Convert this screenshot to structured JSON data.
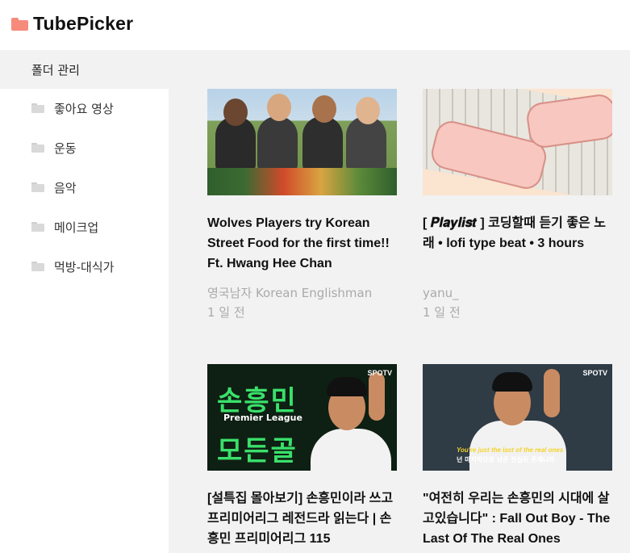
{
  "app": {
    "name": "TubePicker"
  },
  "sidebar": {
    "header": "폴더 관리",
    "items": [
      {
        "label": "좋아요 영상"
      },
      {
        "label": "운동"
      },
      {
        "label": "음악"
      },
      {
        "label": "메이크업"
      },
      {
        "label": "먹방-대식가"
      }
    ]
  },
  "videos": [
    {
      "title": "Wolves Players try Korean Street Food for the first time!! Ft. Hwang Hee Chan",
      "channel": "영국남자 Korean Englishman",
      "date": "1 일 전"
    },
    {
      "title": "[ 𝑷𝒍𝒂𝒚𝒍𝒊𝒔𝒕 ] 코딩할때 듣기 좋은 노래 • lofi type beat • 3 hours",
      "channel": "yanu_",
      "date": "1 일 전"
    },
    {
      "title": "[설특집 몰아보기] 손흥민이라 쓰고 프리미어리그 레전드라 읽는다 | 손흥민 프리미어리그 115",
      "thumb_text": {
        "line1": "손흥민",
        "line2": "모든골",
        "league": "Premier League",
        "badge": "SPOTV"
      }
    },
    {
      "title": "\"여전히 우리는 손흥민의 시대에 살고있습니다\" : Fall Out Boy - The Last Of The Real Ones",
      "thumb_text": {
        "caption_en": "You're just the last of the real ones",
        "caption_ko": "넌 마지막으로 남은 진실된 존재니까",
        "badge": "SPOTV"
      }
    }
  ],
  "colors": {
    "brand": "#f68a7b",
    "main_bg": "#f2f2f2",
    "meta_text": "#aaaaaa"
  }
}
